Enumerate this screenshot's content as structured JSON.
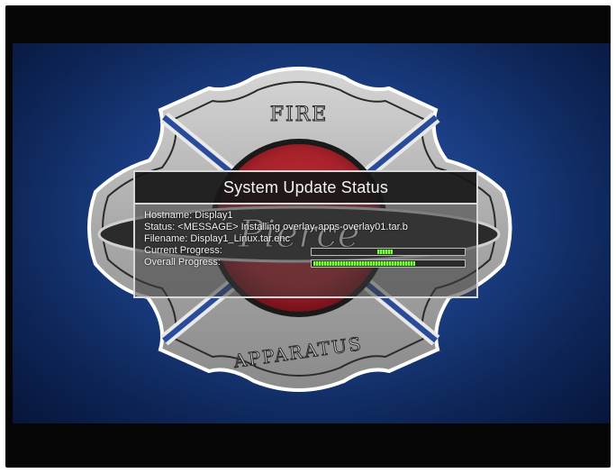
{
  "screen": {
    "background_color": "#1b3f86",
    "emblem": {
      "top_text": "FIRE",
      "bottom_text": "APPARATUS",
      "center_script": "Pierce",
      "colors": {
        "cross_silver": "#b8b8b8",
        "cross_outline": "#ffffff",
        "center_red": "#a8222b",
        "banner_dark": "#2b2b2b"
      }
    }
  },
  "dialog": {
    "title": "System Update Status",
    "hostname_line": "Hostname: Display1",
    "status_line": "Status: <MESSAGE> Installing overlay-apps-overlay01.tar.b",
    "filename_line": "Filename: Display1_Linux.tar.enc",
    "current_progress_label": "Current Progress:",
    "overall_progress_label": "Overall Progress:",
    "current_progress": {
      "fraction": 0.1,
      "position_fraction": 0.42
    },
    "overall_progress": {
      "fraction": 0.67
    },
    "progress_color": "#7dff3a"
  }
}
